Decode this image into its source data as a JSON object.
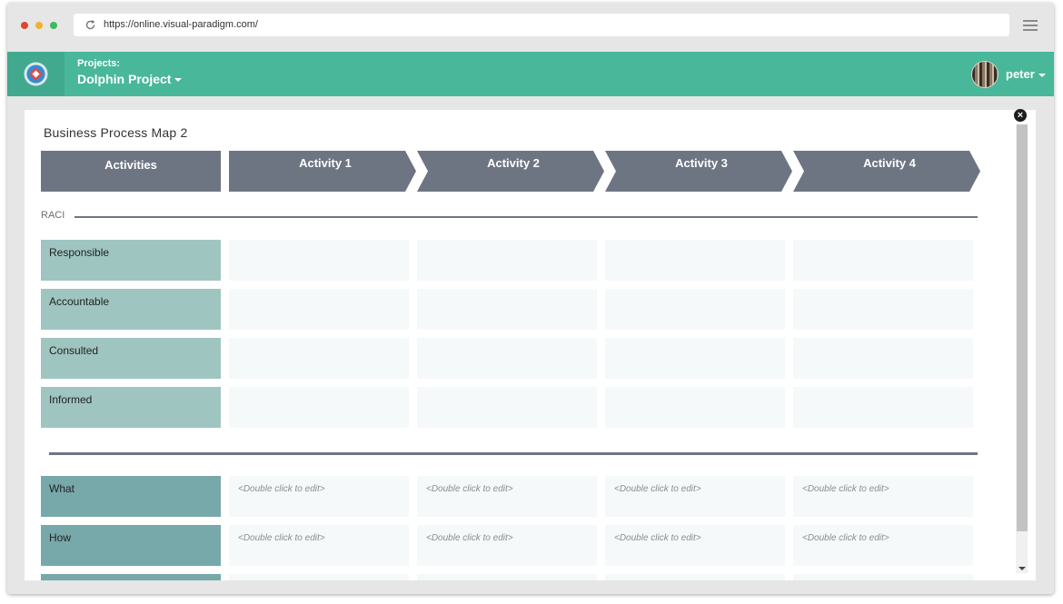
{
  "browser": {
    "url": "https://online.visual-paradigm.com/"
  },
  "header": {
    "projects_label": "Projects:",
    "project_name": "Dolphin Project",
    "user_name": "peter"
  },
  "diagram": {
    "title": "Business Process Map 2",
    "activities_header": "Activities",
    "activities": [
      "Activity 1",
      "Activity 2",
      "Activity 3",
      "Activity 4"
    ],
    "raci_label": "RACI",
    "raci_rows": [
      "Responsible",
      "Accountable",
      "Consulted",
      "Informed"
    ],
    "detail_rows": [
      "What",
      "How"
    ],
    "cell_placeholder": "<Double click to edit>"
  },
  "colors": {
    "brand": "#49b79a",
    "header_cell": "#6e7582",
    "raci_label": "#9fc5c1",
    "detail_label": "#77a8aa"
  }
}
